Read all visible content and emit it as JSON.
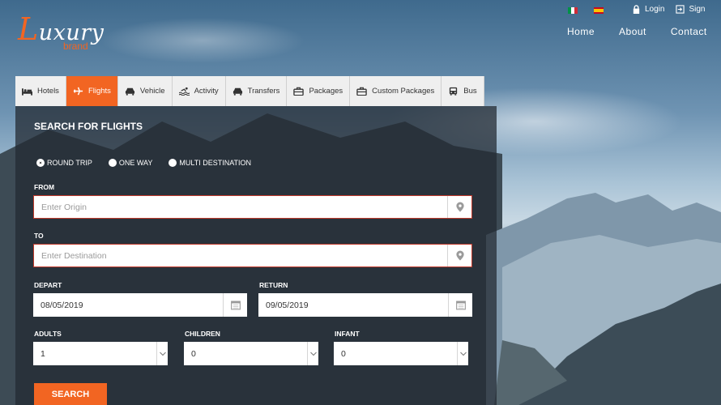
{
  "brand": {
    "logo_text": "uxury",
    "logo_initial": "L",
    "logo_sub": "brand",
    "accent": "#f26522"
  },
  "header": {
    "login_label": "Login",
    "signup_label": "Sign",
    "nav": [
      "Home",
      "About",
      "Contact"
    ]
  },
  "tabs": [
    {
      "label": "Hotels",
      "icon": "bed-icon",
      "active": false
    },
    {
      "label": "Flights",
      "icon": "plane-icon",
      "active": true
    },
    {
      "label": "Vehicle",
      "icon": "car-icon",
      "active": false
    },
    {
      "label": "Activity",
      "icon": "swim-icon",
      "active": false
    },
    {
      "label": "Transfers",
      "icon": "car-icon",
      "active": false
    },
    {
      "label": "Packages",
      "icon": "suitcase-icon",
      "active": false
    },
    {
      "label": "Custom Packages",
      "icon": "suitcase-icon",
      "active": false
    },
    {
      "label": "Bus",
      "icon": "bus-icon",
      "active": false
    }
  ],
  "form": {
    "title": "SEARCH FOR FLIGHTS",
    "trip_types": [
      "ROUND TRIP",
      "ONE WAY",
      "MULTI DESTINATION"
    ],
    "from_label": "FROM",
    "from_placeholder": "Enter Origin",
    "to_label": "TO",
    "to_placeholder": "Enter Destination",
    "depart_label": "DEPART",
    "depart_value": "08/05/2019",
    "return_label": "RETURN",
    "return_value": "09/05/2019",
    "adults_label": "ADULTS",
    "adults_value": "1",
    "children_label": "CHILDREN",
    "children_value": "0",
    "infant_label": "INFANT",
    "infant_value": "0",
    "search_label": "SEARCH"
  }
}
